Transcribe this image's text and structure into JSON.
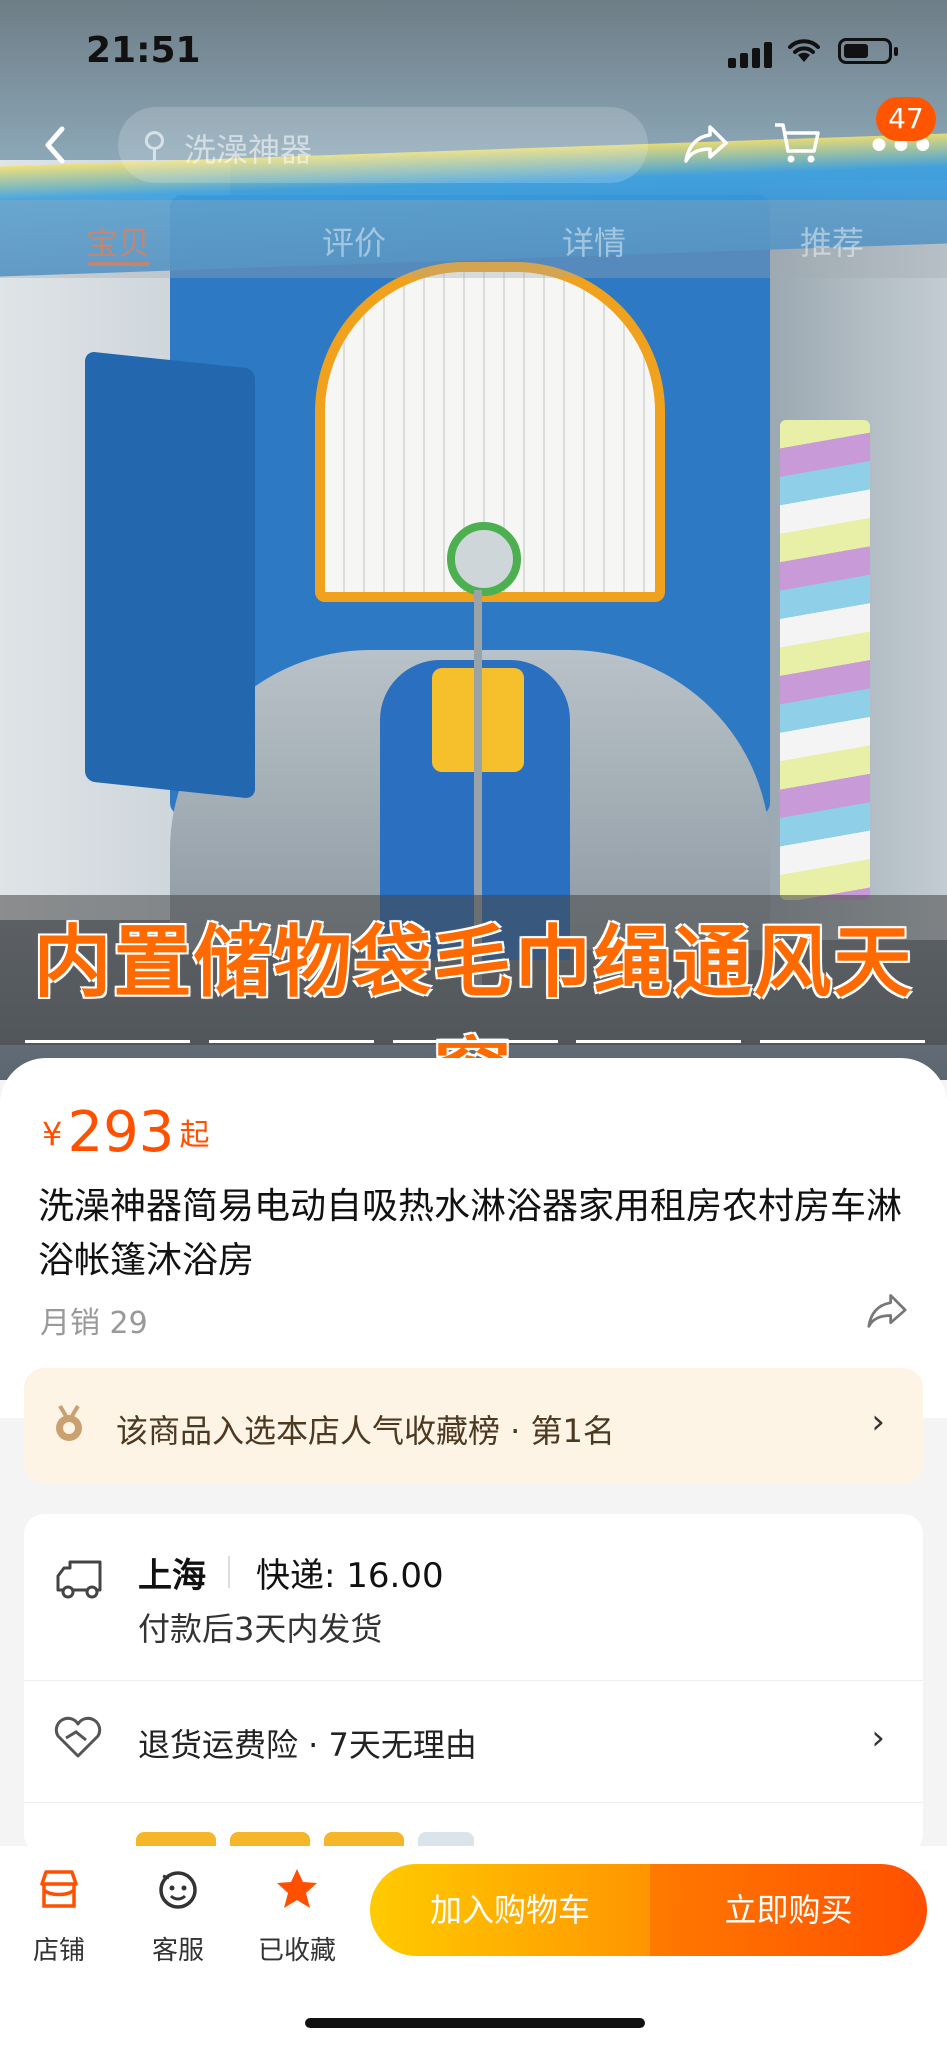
{
  "status_bar": {
    "time": "21:51"
  },
  "nav": {
    "search_placeholder": "洗澡神器",
    "badge_count": "47"
  },
  "tabs": [
    "宝贝",
    "评价",
    "详情",
    "推荐"
  ],
  "hero": {
    "caption": "内置储物袋毛巾绳通风天窗"
  },
  "product": {
    "currency": "¥",
    "price": "293",
    "price_suffix": "起",
    "title": "洗澡神器简易电动自吸热水淋浴器家用租房农村房车淋浴帐篷沐浴房",
    "monthly_sales": "月销 29"
  },
  "ranking": {
    "text": "该商品入选本店人气收藏榜 · 第1名"
  },
  "shipping": {
    "origin": "上海",
    "fee": "快递: 16.00",
    "dispatch": "付款后3天内发货"
  },
  "service": {
    "text": "退货运费险 · 7天无理由"
  },
  "bottom_bar": {
    "store_label": "店铺",
    "service_label": "客服",
    "favorite_label": "已收藏",
    "add_to_cart": "加入购物车",
    "buy_now": "立即购买"
  },
  "colors": {
    "accent": "#ff5000",
    "favorite": "#ff5000",
    "cart_button": "#ffb400",
    "buy_button": "#ff6000"
  }
}
